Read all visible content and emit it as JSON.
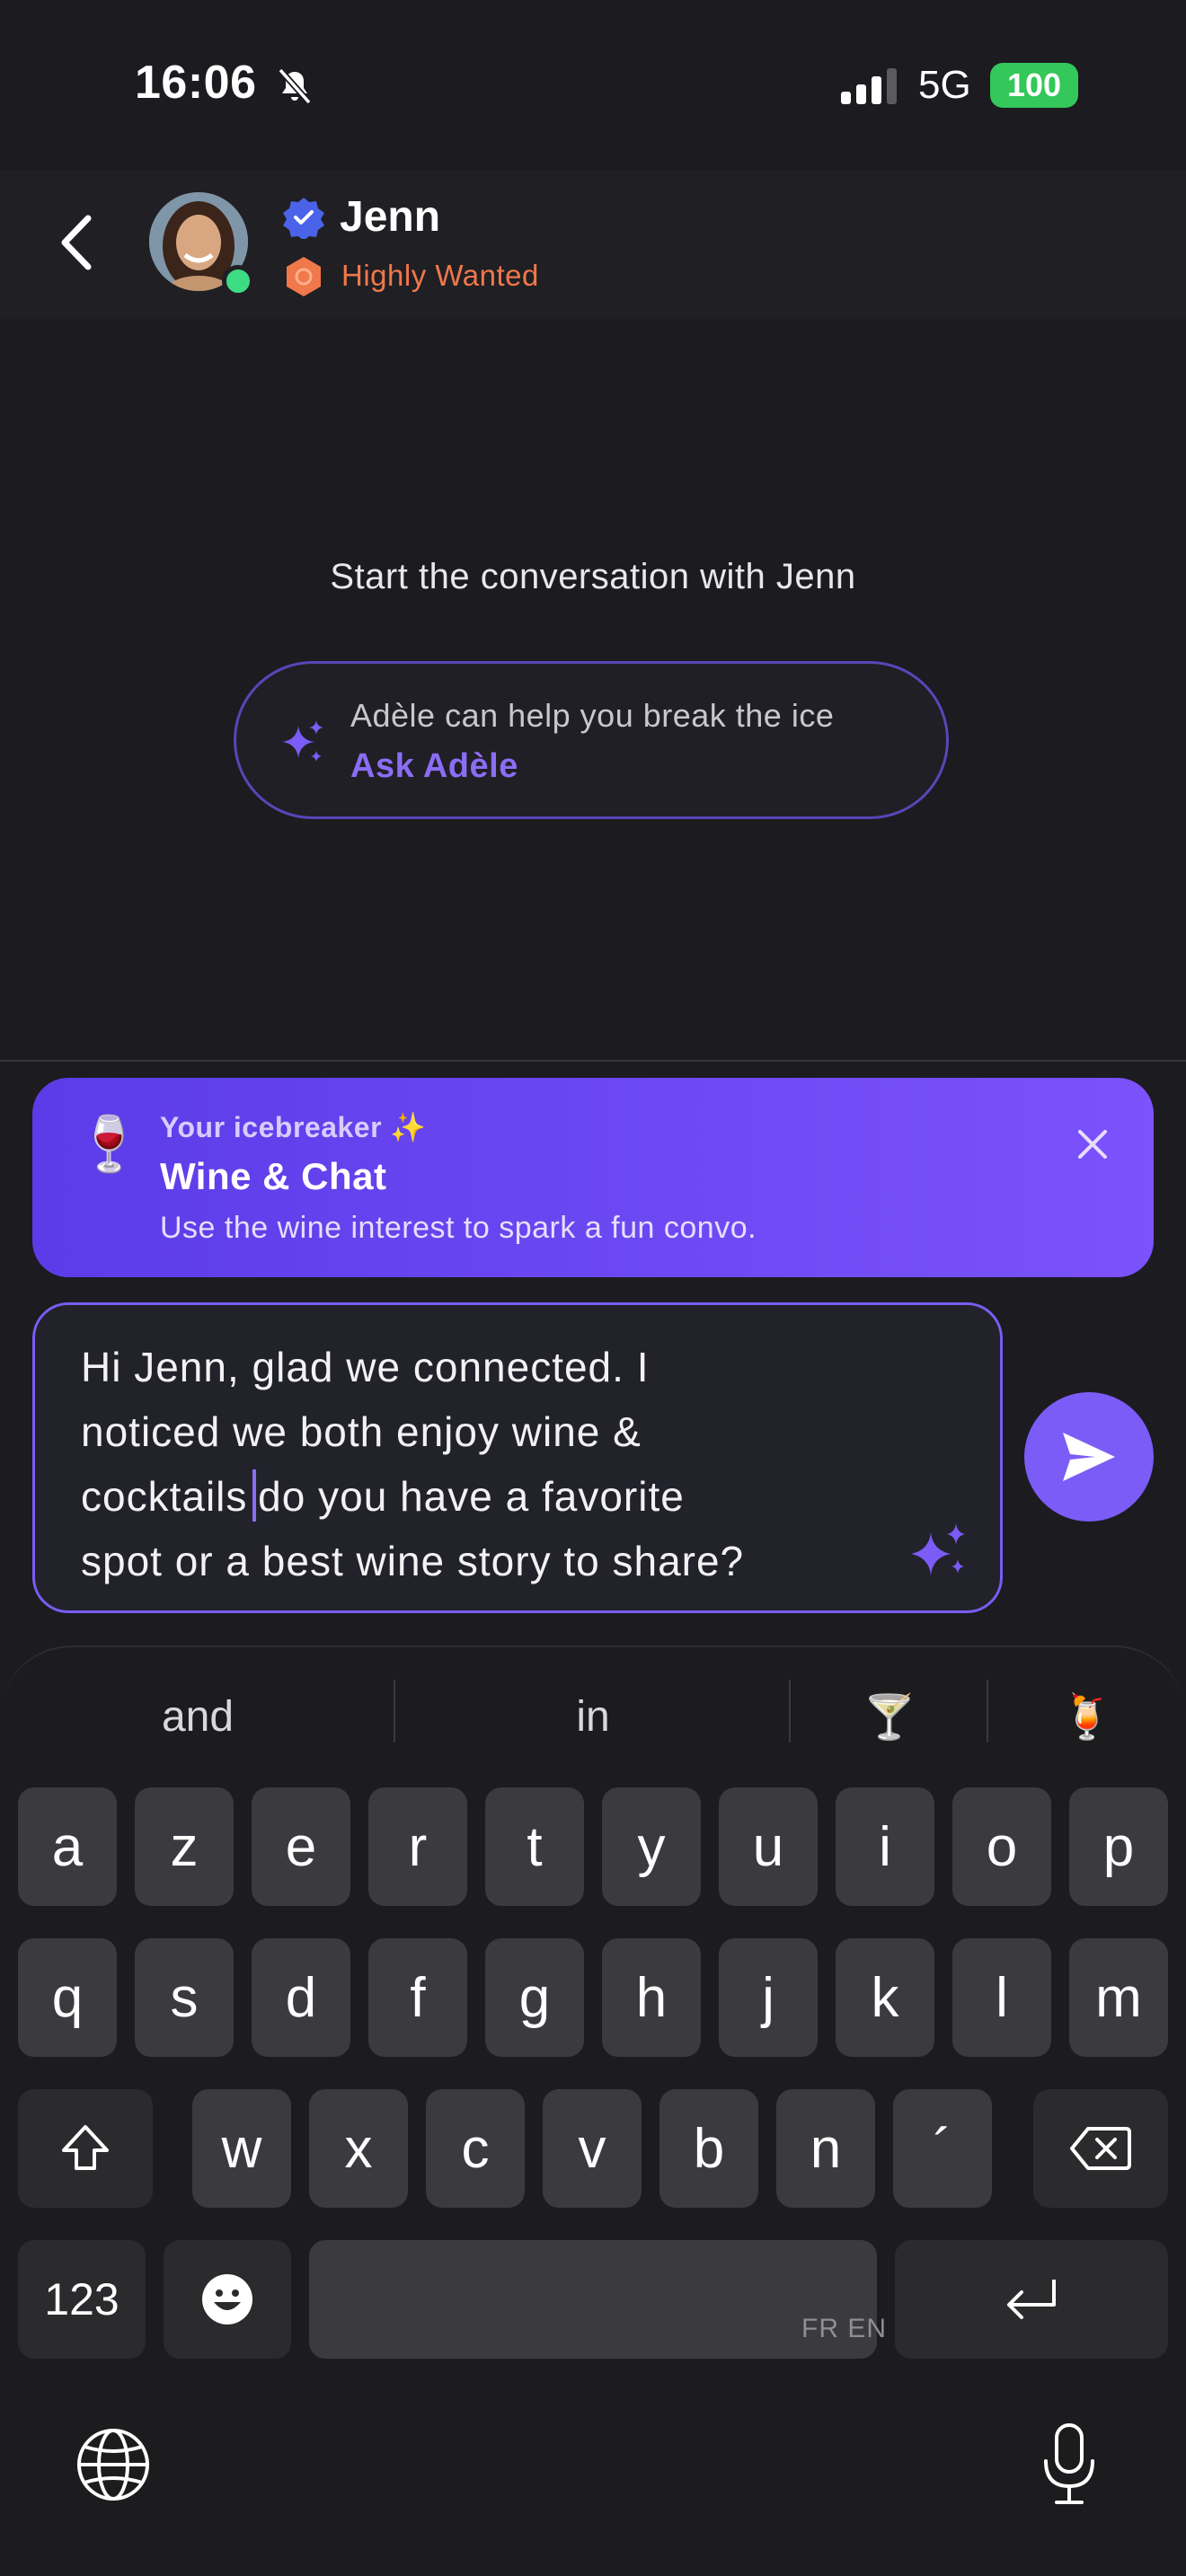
{
  "status": {
    "time": "16:06",
    "network": "5G",
    "battery": "100"
  },
  "header": {
    "name": "Jenn",
    "badge": "Highly Wanted"
  },
  "center": {
    "start_text": "Start the conversation with Jenn",
    "ask_hint": "Adèle can help you break the ice",
    "ask_link": "Ask Adèle"
  },
  "icebreaker": {
    "label": "Your icebreaker ✨",
    "title": "Wine & Chat",
    "description": "Use the wine interest to spark a fun convo.",
    "emoji": "🍷"
  },
  "message": {
    "line1": "Hi Jenn, glad we connected. I",
    "line2": "noticed we both enjoy wine &",
    "line3a": "cocktails ",
    "line3b": "do you have a favorite",
    "line4": "spot or a best wine story to share?"
  },
  "keyboard": {
    "suggestions": [
      "and",
      "in",
      "🍸",
      "🍹"
    ],
    "row1": [
      "a",
      "z",
      "e",
      "r",
      "t",
      "y",
      "u",
      "i",
      "o",
      "p"
    ],
    "row2": [
      "q",
      "s",
      "d",
      "f",
      "g",
      "h",
      "j",
      "k",
      "l",
      "m"
    ],
    "row3": [
      "w",
      "x",
      "c",
      "v",
      "b",
      "n",
      "´"
    ],
    "numbers_label": "123",
    "space_languages": "FR EN"
  },
  "colors": {
    "accent": "#7c5cf6",
    "badge": "#f0784a",
    "online": "#3ddc84",
    "battery": "#34c759"
  }
}
